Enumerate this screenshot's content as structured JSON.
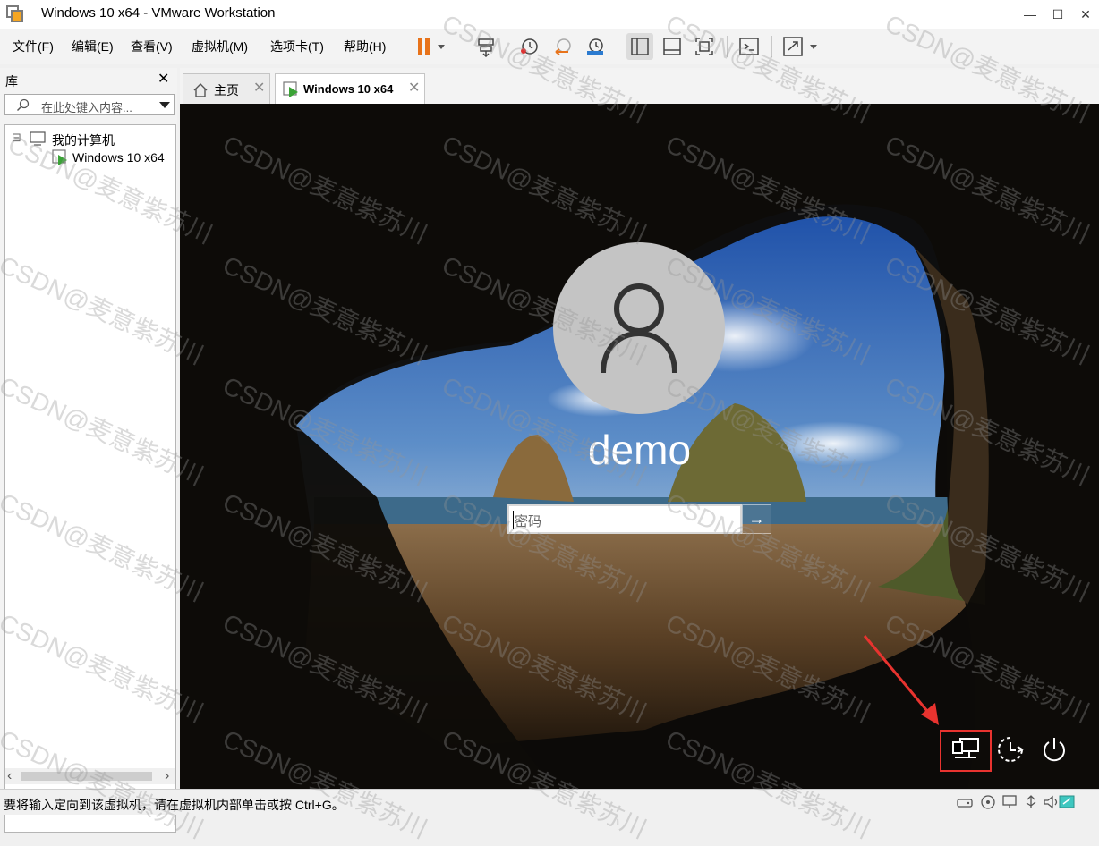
{
  "window": {
    "title": "Windows 10 x64 - VMware Workstation",
    "controls": {
      "minimize": "—",
      "maximize": "☐",
      "close": "✕"
    }
  },
  "menu": [
    "文件(F)",
    "编辑(E)",
    "查看(V)",
    "虚拟机(M)",
    "选项卡(T)",
    "帮助(H)"
  ],
  "toolbar": {
    "icons": [
      "pause-icon",
      "send-ctrl-alt-del-icon",
      "snapshot-icon",
      "revert-snapshot-icon",
      "snapshot-manager-icon",
      "library-view-icon",
      "thumbnail-view-icon",
      "fit-guest-icon",
      "console-view-icon",
      "fullscreen-icon"
    ],
    "accent_pause": "#e8731a"
  },
  "library": {
    "title": "库",
    "close": "✕",
    "search_placeholder": "在此处键入内容...",
    "tree": [
      {
        "label": "我的计算机",
        "expander": "⊟"
      },
      {
        "label": "Windows 10 x64"
      }
    ],
    "scroll_left": "‹",
    "scroll_right": "›"
  },
  "tabs": [
    {
      "label": "主页",
      "close": "✕",
      "active": false
    },
    {
      "label": "Windows 10 x64",
      "close": "✕",
      "active": true
    }
  ],
  "login": {
    "username": "demo",
    "password_placeholder": "密码",
    "submit_arrow": "→"
  },
  "corner_buttons": [
    "network-icon",
    "ease-of-access-icon",
    "power-icon"
  ],
  "annotation_color": "#e8332f",
  "status": {
    "text": "要将输入定向到该虚拟机，请在虚拟机内部单击或按 Ctrl+G。",
    "icons": [
      "hard-disk-icon",
      "cd-dvd-icon",
      "network-adapter-icon",
      "usb-icon",
      "sound-icon",
      "message-icon"
    ]
  },
  "watermark": "CSDN@麦意紫苏川"
}
